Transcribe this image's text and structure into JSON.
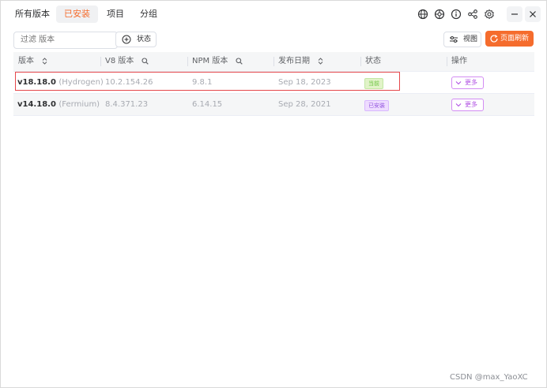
{
  "tabs": [
    {
      "label": "所有版本",
      "active": false
    },
    {
      "label": "已安装",
      "active": true
    },
    {
      "label": "项目",
      "active": false
    },
    {
      "label": "分组",
      "active": false
    }
  ],
  "top_icons": [
    "globe-icon",
    "aperture-icon",
    "info-icon",
    "share-icon",
    "gear-icon"
  ],
  "toolbar": {
    "search_placeholder": "过滤 版本",
    "status_label": "状态",
    "view_label": "视图",
    "refresh_label": "页面刷新"
  },
  "table": {
    "headers": [
      "版本",
      "V8 版本",
      "NPM 版本",
      "发布日期",
      "状态",
      "操作"
    ],
    "rows": [
      {
        "version": "v18.18.0",
        "codename": "(Hydrogen)",
        "v8": "10.2.154.26",
        "npm": "9.8.1",
        "date": "Sep 18, 2023",
        "status": "当前",
        "status_type": "current",
        "action": "更多"
      },
      {
        "version": "v14.18.0",
        "codename": "(Fermium)",
        "v8": "8.4.371.23",
        "npm": "6.14.15",
        "date": "Sep 28, 2021",
        "status": "已安装",
        "status_type": "installed",
        "action": "更多"
      }
    ]
  },
  "colors": {
    "accent": "#f56c2d",
    "current_badge": "#67c23a",
    "installed_badge": "#9254de",
    "more_button": "#b152e3",
    "highlight_box": "#e5474b"
  },
  "watermark": "CSDN @max_YaoXC"
}
